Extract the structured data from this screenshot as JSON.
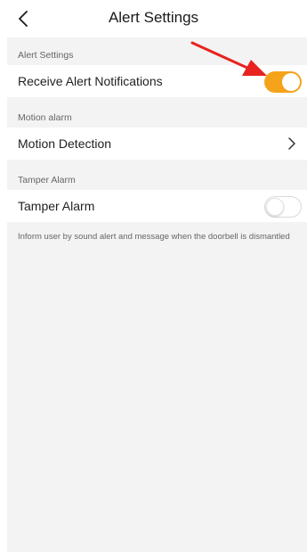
{
  "header": {
    "title": "Alert Settings"
  },
  "sections": [
    {
      "label": "Alert Settings",
      "row_label": "Receive Alert Notifications",
      "control": "toggle",
      "toggle_on": true
    },
    {
      "label": "Motion alarm",
      "row_label": "Motion Detection",
      "control": "chevron"
    },
    {
      "label": "Tamper Alarm",
      "row_label": "Tamper Alarm",
      "control": "toggle",
      "toggle_on": false
    }
  ],
  "tamper_description": "Inform user by sound alert and message when the doorbell is dismantled",
  "colors": {
    "accent": "#f5a31a",
    "annotation_arrow": "#e8231f",
    "page_background": "#f3f3f3"
  },
  "icons": {
    "back": "chevron-left-icon",
    "row_nav": "chevron-right-icon",
    "annotation": "red-arrow-pointer"
  }
}
